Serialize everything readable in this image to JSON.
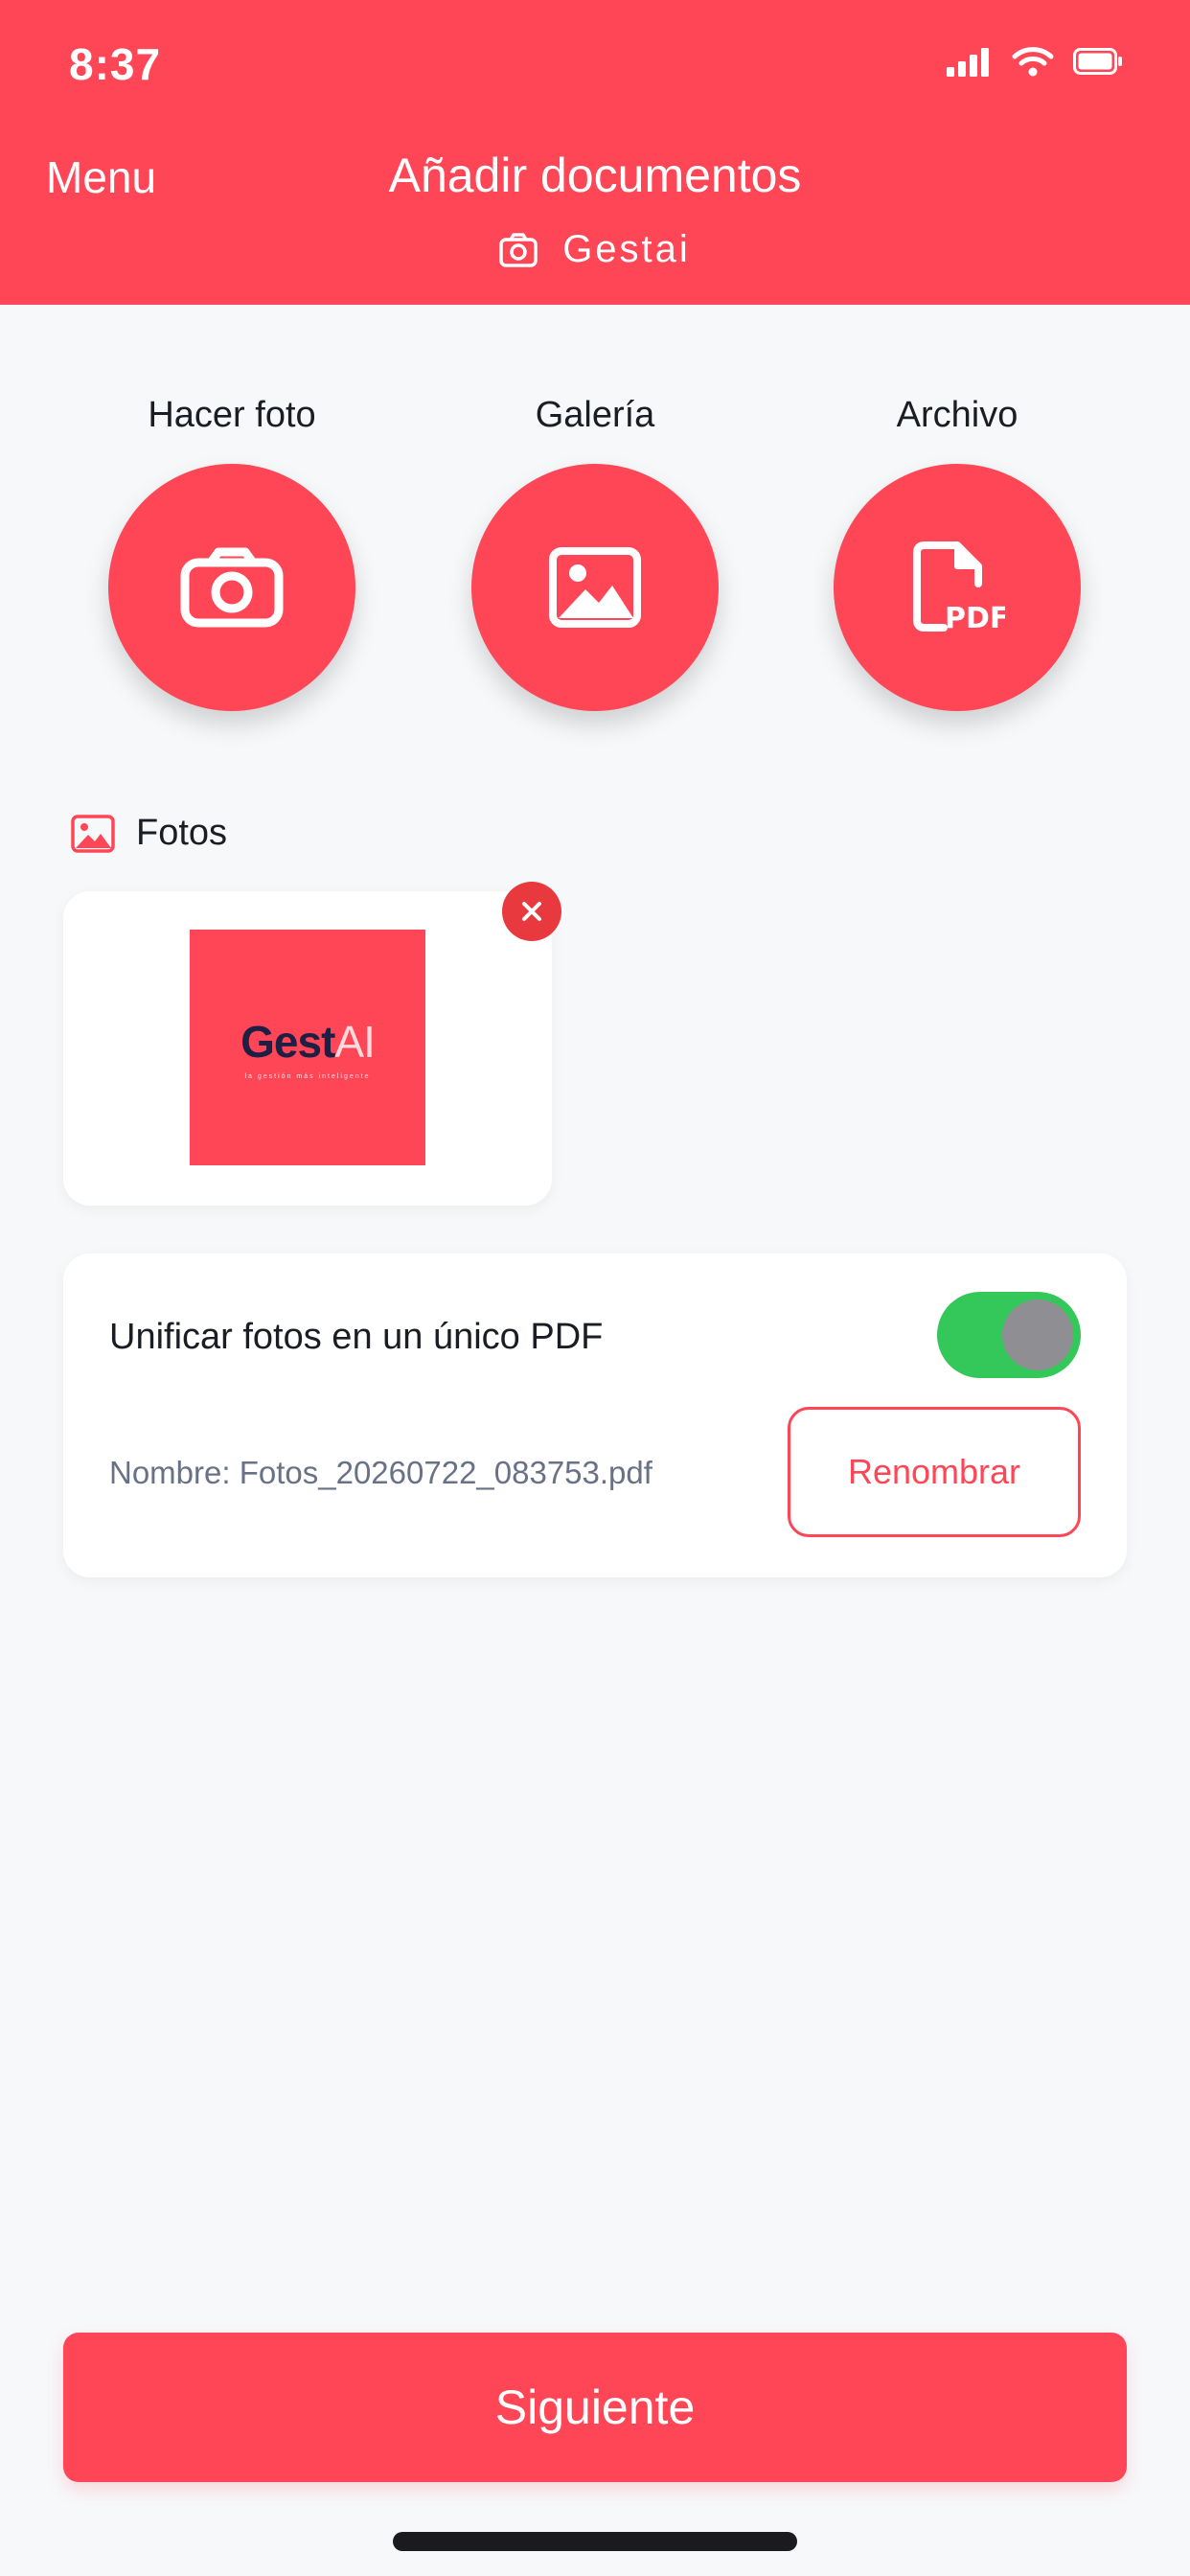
{
  "status_bar": {
    "time": "8:37",
    "icons": [
      "signal-icon",
      "wifi-icon",
      "battery-icon"
    ]
  },
  "header": {
    "menu_label": "Menu",
    "title": "Añadir documentos",
    "subtitle": "Gestai",
    "subtitle_icon": "camera-icon"
  },
  "actions": [
    {
      "label": "Hacer foto",
      "icon": "camera-icon"
    },
    {
      "label": "Galería",
      "icon": "image-icon"
    },
    {
      "label": "Archivo",
      "icon": "pdf-file-icon"
    }
  ],
  "photos_section": {
    "title": "Fotos",
    "icon": "image-icon",
    "items": [
      {
        "brand_main": "Gest",
        "brand_accent": "AI",
        "tagline": "la gestión más inteligente"
      }
    ]
  },
  "merge_options": {
    "label": "Unificar fotos en un único PDF",
    "enabled": true,
    "file_name": "Nombre: Fotos_20260722_083753.pdf",
    "rename_label": "Renombrar"
  },
  "footer": {
    "next_label": "Siguiente"
  },
  "colors": {
    "accent": "#fe4656",
    "toggle_on": "#34c759",
    "remove": "#e8393f",
    "background": "#f7f8fa"
  }
}
